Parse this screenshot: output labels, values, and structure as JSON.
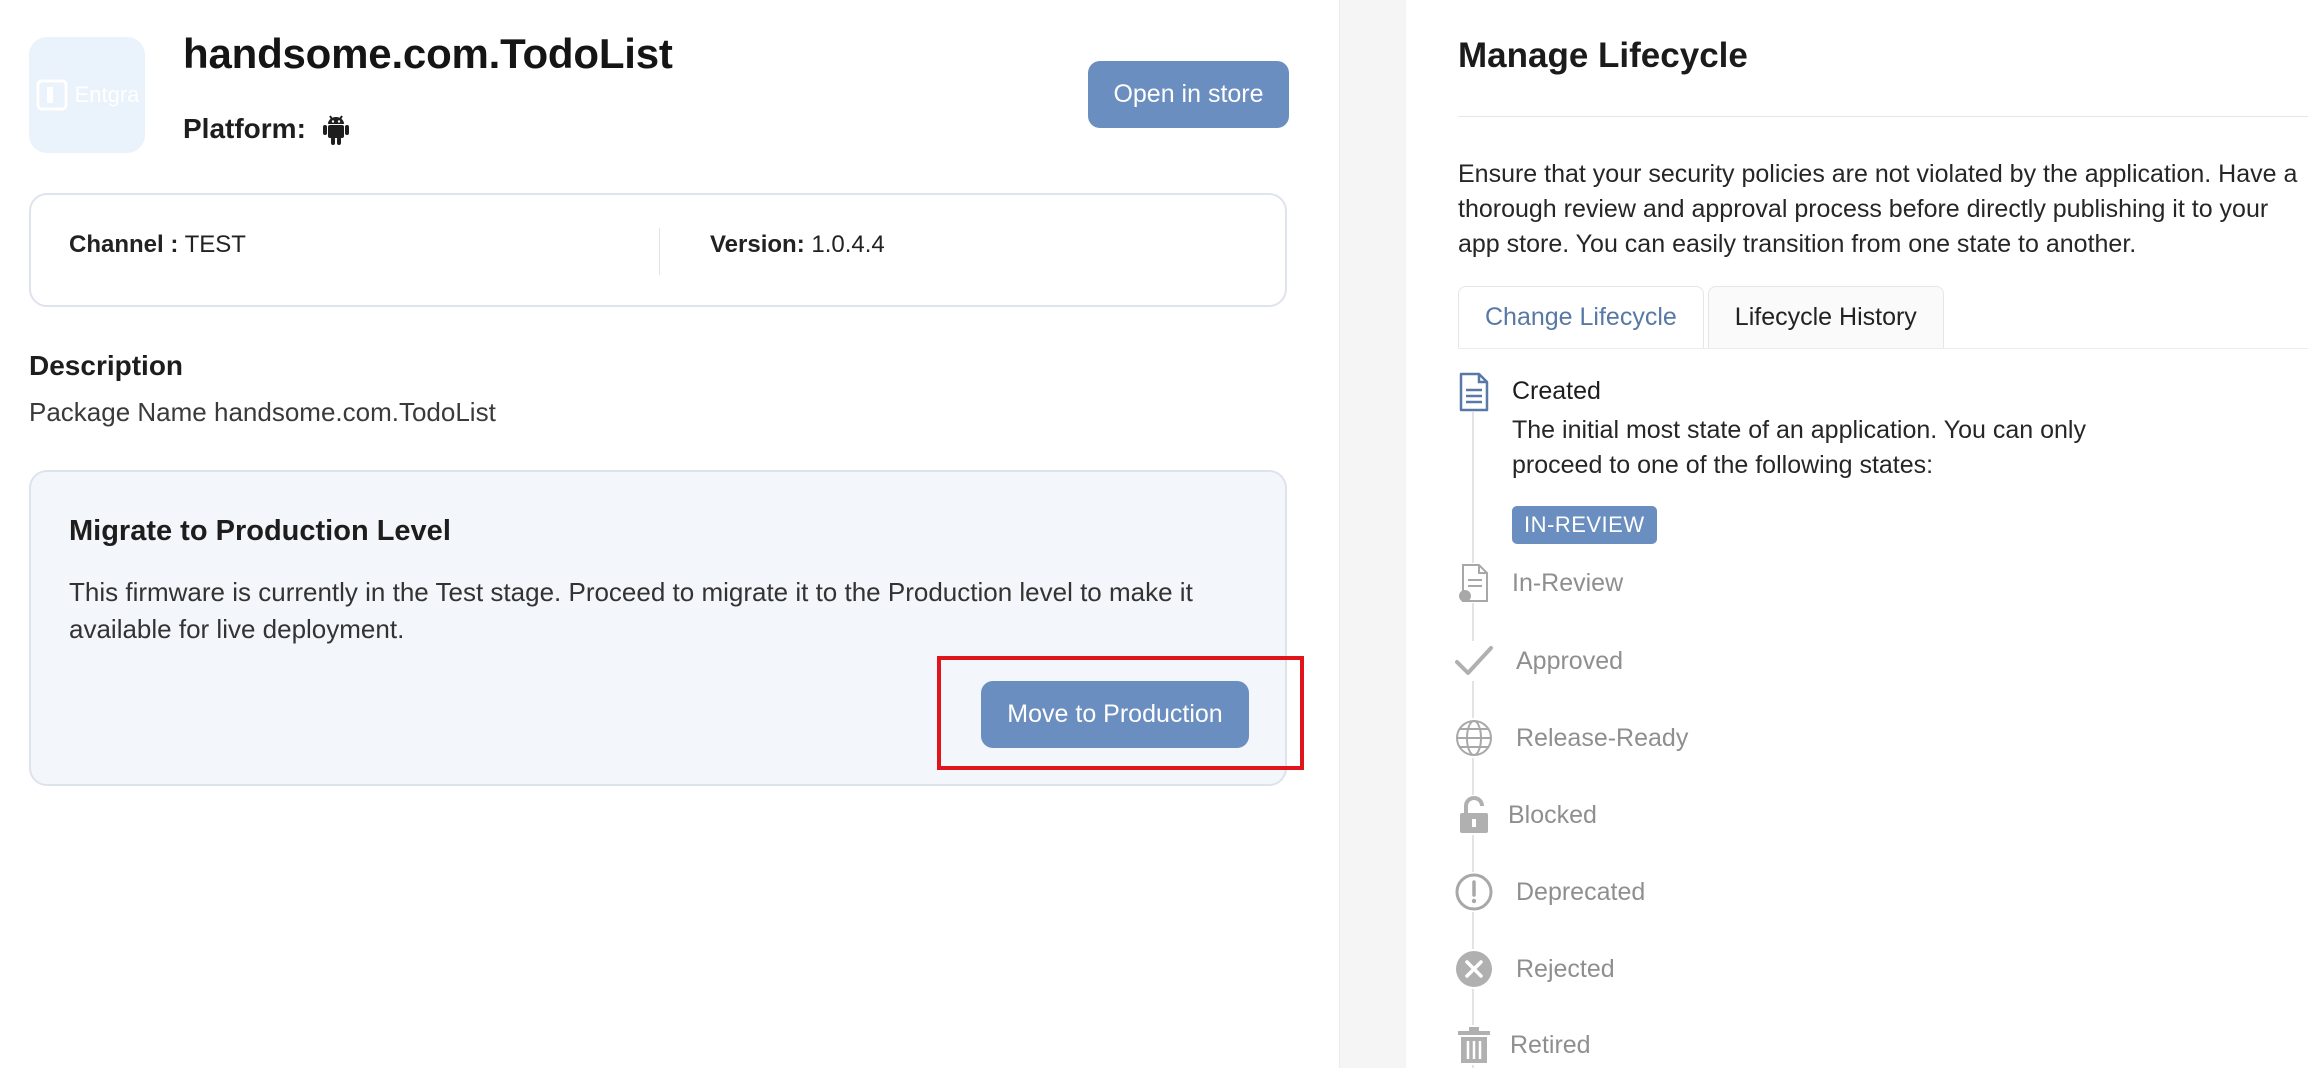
{
  "app": {
    "logo_text": "Entgra",
    "title": "handsome.com.TodoList",
    "platform_label": "Platform:",
    "platform_icon": "android-icon",
    "open_store_label": "Open in store"
  },
  "info": {
    "channel_label": "Channel :",
    "channel_value": "TEST",
    "version_label": "Version:",
    "version_value": "1.0.4.4"
  },
  "description": {
    "title": "Description",
    "text": "Package Name handsome.com.TodoList"
  },
  "migrate": {
    "title": "Migrate to Production Level",
    "text": "This firmware is currently in the Test stage. Proceed to migrate it to the Production level to make it available for live deployment.",
    "button_label": "Move to Production"
  },
  "lifecycle": {
    "title": "Manage Lifecycle",
    "description": "Ensure that your security policies are not violated by the application. Have a thorough review and approval process before directly publishing it to your app store. You can easily transition from one state to another.",
    "tabs": [
      {
        "label": "Change Lifecycle",
        "active": true
      },
      {
        "label": "Lifecycle History",
        "active": false
      }
    ],
    "current": {
      "label": "Created",
      "icon": "document-icon",
      "description": "The initial most state of an application. You can only proceed to one of the following states:",
      "next_state": "IN-REVIEW"
    },
    "states": [
      {
        "label": "In-Review",
        "icon": "review-document-icon"
      },
      {
        "label": "Approved",
        "icon": "check-icon"
      },
      {
        "label": "Release-Ready",
        "icon": "globe-icon"
      },
      {
        "label": "Blocked",
        "icon": "lock-icon"
      },
      {
        "label": "Deprecated",
        "icon": "exclamation-circle-icon"
      },
      {
        "label": "Rejected",
        "icon": "close-circle-icon"
      },
      {
        "label": "Retired",
        "icon": "trash-icon"
      }
    ]
  },
  "colors": {
    "primary": "#6a8ebf",
    "highlight": "#e0151c",
    "muted": "#8f8f8f"
  }
}
